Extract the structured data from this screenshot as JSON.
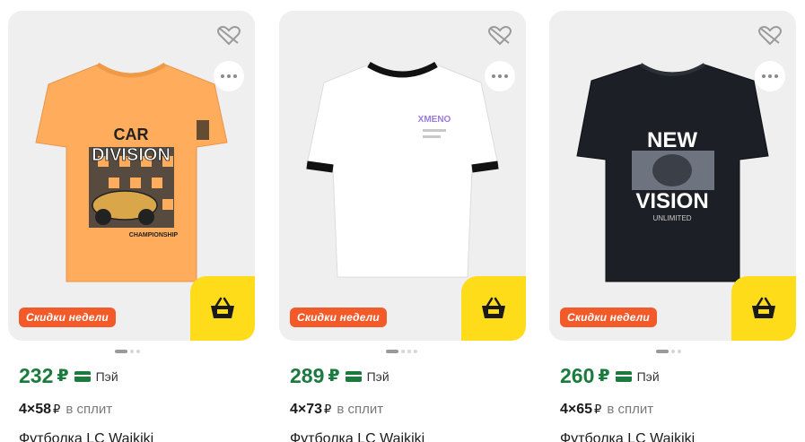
{
  "cards": [
    {
      "title": "Футболка LC Waikiki",
      "price": "232",
      "currency": "₽",
      "pay_label": "Пэй",
      "split_amount": "4×58",
      "split_currency": "₽",
      "split_label": "в сплит",
      "badge": "Скидки недели",
      "shirt_color": "#ffad5c",
      "print_lines": [
        "CAR",
        "DIVISION"
      ],
      "print_sub": "CHAMPIONSHIP"
    },
    {
      "title": "Футболка LC Waikiki",
      "price": "289",
      "currency": "₽",
      "pay_label": "Пэй",
      "split_amount": "4×73",
      "split_currency": "₽",
      "split_label": "в сплит",
      "badge": "Скидки недели",
      "shirt_color": "#ffffff",
      "print_lines": [
        "XMENO"
      ],
      "print_sub": ""
    },
    {
      "title": "Футболка LC Waikiki",
      "price": "260",
      "currency": "₽",
      "pay_label": "Пэй",
      "split_amount": "4×65",
      "split_currency": "₽",
      "split_label": "в сплит",
      "badge": "Скидки недели",
      "shirt_color": "#1c1f26",
      "print_lines": [
        "NEW",
        "VISION"
      ],
      "print_sub": "UNLIMITED"
    }
  ],
  "colors": {
    "price_green": "#1b7a3e",
    "cart_yellow": "#ffdc1a",
    "badge_orange": "#f25a2a"
  },
  "icons": {
    "favorite": "heart-outline-icon",
    "more": "more-dots-icon",
    "cart": "basket-icon",
    "pay": "card-icon"
  }
}
